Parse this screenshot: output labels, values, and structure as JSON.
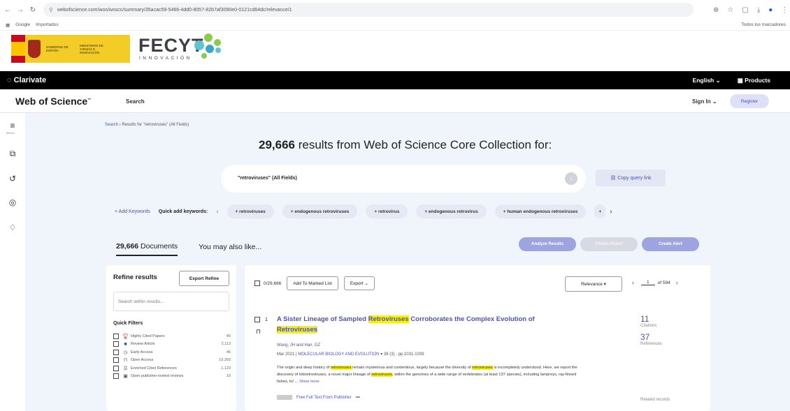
{
  "browser": {
    "url": "webofscience.com/wos/woscc/summary/35acac59-5466-4dd0-8057-82b7af3090e0-0121cd64dc/relevance/1",
    "bookmarks": [
      "Google",
      "Importados"
    ],
    "bookmarks_right": "Todos los marcadores"
  },
  "banner": {
    "gov_line1": "GOBIERNO DE ESPAÑA",
    "gov_line2": "MINISTERIO DE CIENCIA E INNOVACIÓN",
    "brand": "FECYT",
    "brand_sub": "INNOVACIÓN",
    "dot_colors": [
      "#5fc4cf",
      "#8ccb4a",
      "#3aa6c7"
    ]
  },
  "topbar": {
    "logo": "Clarivate",
    "language": "English",
    "products": "Products"
  },
  "wos_header": {
    "logo": "Web of Science",
    "search": "Search",
    "sign_in": "Sign In",
    "register": "Register"
  },
  "rail": {
    "menu_label": "MENU",
    "icons": [
      "menu-icon",
      "clipboard-icon",
      "history-icon",
      "alert-icon",
      "bell-icon"
    ]
  },
  "breadcrumb": {
    "search": "Search",
    "current": "Results for \"retroviruses\" (All Fields)"
  },
  "heading": {
    "count": "29,666",
    "text": "results from Web of Science Core Collection for:"
  },
  "query": {
    "text": "\"retroviruses\" (All Fields)",
    "copy_link": "Copy query link"
  },
  "keywords": {
    "add": "+ Add Keywords",
    "label": "Quick add keywords:",
    "chips": [
      "+ retroviruses",
      "+ endogenous retroviruses",
      "+ retrovirus",
      "+ endogenous retrovirus",
      "+ human endogenous retroviruses"
    ],
    "partial_chip": "+"
  },
  "tabs": {
    "documents_count": "29,666",
    "documents_label": "Documents",
    "also_like": "You may also like..."
  },
  "actions": {
    "analyze": "Analyze Results",
    "citation": "Citation Report",
    "alert": "Create Alert"
  },
  "refine": {
    "title": "Refine results",
    "export": "Export Refine",
    "search_placeholder": "Search within results...",
    "quick_filters_title": "Quick Filters",
    "filters": [
      {
        "label": "Highly Cited Papers",
        "count": "40",
        "icon": "trophy-icon",
        "color": "#c0392b"
      },
      {
        "label": "Review Article",
        "count": "2,113",
        "icon": "review-icon",
        "color": "#1f4fb5"
      },
      {
        "label": "Early Access",
        "count": "46",
        "icon": "clock-icon",
        "color": "#4b52b8"
      },
      {
        "label": "Open Access",
        "count": "10,293",
        "icon": "lock-open-icon",
        "color": "#333"
      },
      {
        "label": "Enriched Cited References",
        "count": "1,123",
        "icon": "list-icon",
        "color": "#333"
      },
      {
        "label": "Open publisher-invited reviews",
        "count": "10",
        "icon": "review-box-icon",
        "color": "#333"
      }
    ]
  },
  "results_toolbar": {
    "selected": "0/29,666",
    "add_marked": "Add To Marked List",
    "export": "Export",
    "sort": "Relevance",
    "page_current": "1",
    "page_total": "of 594"
  },
  "record": {
    "number": "1",
    "title_pre": "A Sister Lineage of Sampled ",
    "title_hl": "Retroviruses",
    "title_mid": " Corroborates the Complex Evolution of ",
    "title_hl2": "Retroviruses",
    "author1": "Wang, JH",
    "and": "and",
    "author2": "Han, GZ",
    "date": "Mar 2021",
    "journal": "MOLECULAR BIOLOGY AND EVOLUTION",
    "volume": "38 (3) , pp.1031-1039",
    "abstract_1": "The origin and deep history of ",
    "abstract_hl1": "retroviruses",
    "abstract_2": " remain mysterious and contentious, largely because the diversity of ",
    "abstract_hl2": "retroviruses",
    "abstract_3": " is incompletely understood. Here, we report the discovery of lokiretroviruses, a novel major lineage of ",
    "abstract_hl3": "retroviruses",
    "abstract_4": ", within the genomes of a wide range of vertebrates (at least 137 species), including lampreys, ray-finned fishes, lo/ ...",
    "show_more": "Show more",
    "fulltext": "Free Full Text From Publisher",
    "more": "•••",
    "citations_count": "11",
    "citations_label": "Citations",
    "references_count": "37",
    "references_label": "References",
    "related": "Related records"
  }
}
